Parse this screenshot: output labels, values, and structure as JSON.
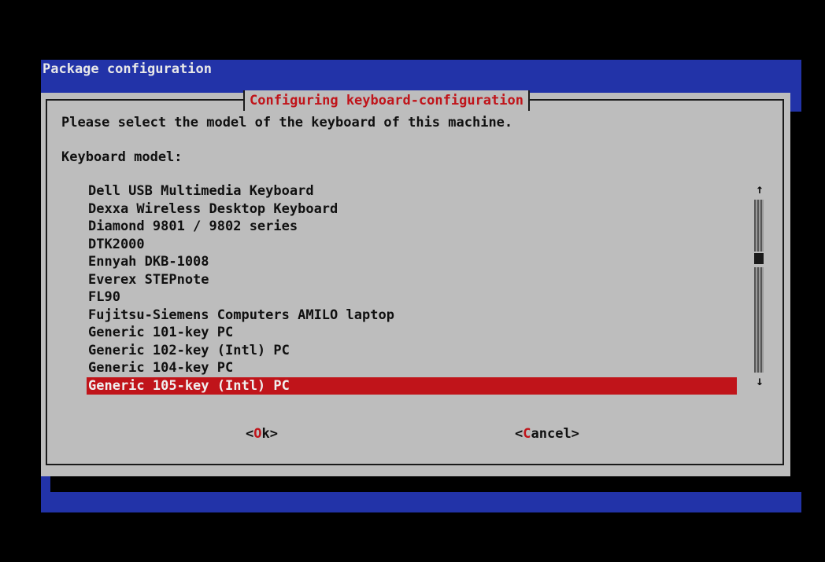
{
  "backtitle": "Package configuration",
  "dialog": {
    "title": "Configuring keyboard-configuration",
    "prompt": "Please select the model of the keyboard of this machine.",
    "list_label": "Keyboard model:",
    "items": [
      "Dell USB Multimedia Keyboard",
      "Dexxa Wireless Desktop Keyboard",
      "Diamond 9801 / 9802 series",
      "DTK2000",
      "Ennyah DKB-1008",
      "Everex STEPnote",
      "FL90",
      "Fujitsu-Siemens Computers AMILO laptop",
      "Generic 101-key PC",
      "Generic 102-key (Intl) PC",
      "Generic 104-key PC",
      "Generic 105-key (Intl) PC"
    ],
    "selected_item": "Generic 105-key (Intl) PC",
    "ok_button": "<Ok>",
    "cancel_button": "<Cancel>"
  },
  "scrollbar": {
    "up_arrow": "↑",
    "down_arrow": "↓"
  },
  "colors": {
    "background": "#000000",
    "backdrop_blue": "#2233a8",
    "dialog_gray": "#bdbdbd",
    "accent_red": "#c0141a"
  }
}
